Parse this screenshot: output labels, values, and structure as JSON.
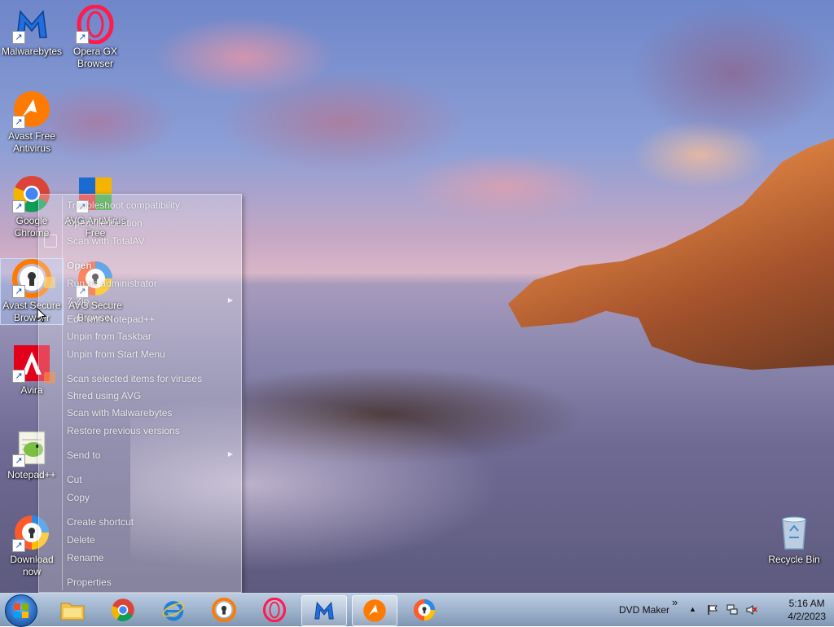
{
  "desktop": {
    "icons": [
      {
        "label": "Malwarebytes",
        "name": "malwarebytes"
      },
      {
        "label": "Opera GX Browser",
        "name": "opera-gx-browser"
      },
      {
        "label": "Avast Free Antivirus",
        "name": "avast-free-antivirus"
      },
      {
        "label": "Google Chrome",
        "name": "google-chrome"
      },
      {
        "label": "AVG AntiVirus Free",
        "name": "avg-antivirus-free"
      },
      {
        "label": "Avast Secure Browser",
        "name": "avast-secure-browser"
      },
      {
        "label": "AVG Secure Browser",
        "name": "avg-secure-browser"
      },
      {
        "label": "Avira",
        "name": "avira"
      },
      {
        "label": "Notepad++",
        "name": "notepad-plus-plus"
      },
      {
        "label": "Download now",
        "name": "download-now"
      },
      {
        "label": "Recycle Bin",
        "name": "recycle-bin"
      }
    ]
  },
  "context_menu": {
    "items": [
      {
        "label": "Troubleshoot compatibility"
      },
      {
        "label": "Open file location"
      },
      {
        "label": "Scan with TotalAV"
      },
      {
        "label": "Open"
      },
      {
        "label": "Run as administrator"
      },
      {
        "label": "7-Zip"
      },
      {
        "label": "Edit with Notepad++"
      },
      {
        "label": "Unpin from Taskbar"
      },
      {
        "label": "Unpin from Start Menu"
      },
      {
        "label": "Scan selected items for viruses"
      },
      {
        "label": "Shred using AVG"
      },
      {
        "label": "Scan with Malwarebytes"
      },
      {
        "label": "Restore previous versions"
      },
      {
        "label": "Send to"
      },
      {
        "label": "Cut"
      },
      {
        "label": "Copy"
      },
      {
        "label": "Create shortcut"
      },
      {
        "label": "Delete"
      },
      {
        "label": "Rename"
      },
      {
        "label": "Properties"
      }
    ]
  },
  "taskbar": {
    "pinned": [
      "file-explorer",
      "google-chrome",
      "internet-explorer",
      "avast-secure-browser",
      "opera-gx",
      "malwarebytes",
      "avast-antivirus",
      "avg-secure-browser"
    ],
    "toolbar_label": "DVD Maker",
    "toolbar_chevron": "»",
    "tray_expand": "▲",
    "clock_time": "5:16 AM",
    "clock_date": "4/2/2023"
  },
  "colors": {
    "taskbar": "#9fb4cf",
    "accent": "#2d6fc4"
  }
}
